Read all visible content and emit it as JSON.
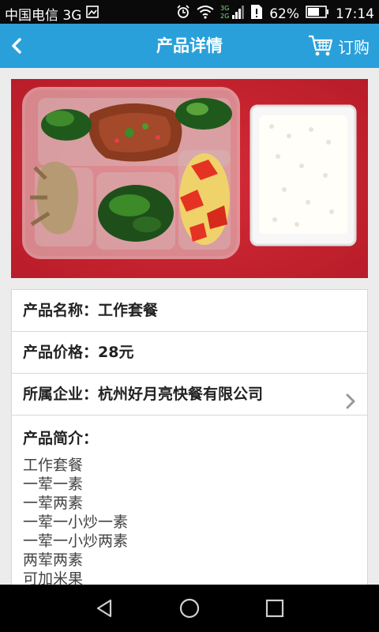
{
  "status_bar": {
    "carrier": "中国电信 3G",
    "network_top": "3G",
    "network_bottom": "2G",
    "battery": "62%",
    "time": "17:14"
  },
  "header": {
    "title": "产品详情",
    "order_label": "订购"
  },
  "product": {
    "name_row": "产品名称：工作套餐",
    "price_row": "产品价格：28元",
    "company_row": "所属企业：杭州好月亮快餐有限公司",
    "intro_title": "产品简介：",
    "intro_lines": [
      "工作套餐",
      "一荤一素",
      "一荤两素",
      "一荤一小炒一素",
      "一荤一小炒两素",
      "两荤两素",
      "可加米果"
    ]
  },
  "colors": {
    "accent": "#2aa0da",
    "photo_background": "#c8232f"
  }
}
